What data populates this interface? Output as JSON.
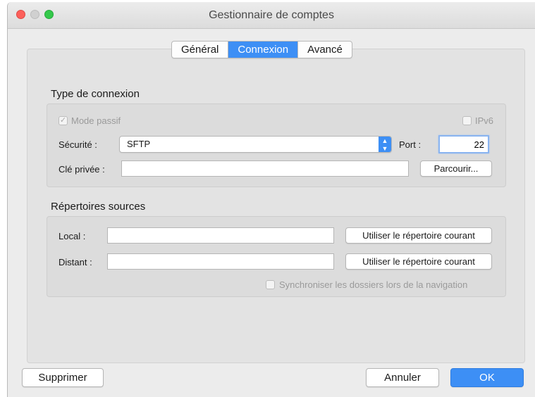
{
  "window": {
    "title": "Gestionnaire de comptes"
  },
  "tabs": [
    {
      "label": "Général",
      "active": false
    },
    {
      "label": "Connexion",
      "active": true
    },
    {
      "label": "Avancé",
      "active": false
    }
  ],
  "connection": {
    "section_title": "Type de connexion",
    "passive_mode_label": "Mode passif",
    "passive_mode_checked": true,
    "ipv6_label": "IPv6",
    "ipv6_checked": false,
    "security_label": "Sécurité :",
    "security_value": "SFTP",
    "port_label": "Port :",
    "port_value": "22",
    "private_key_label": "Clé privée :",
    "private_key_value": "",
    "browse_label": "Parcourir..."
  },
  "directories": {
    "section_title": "Répertoires sources",
    "local_label": "Local :",
    "local_value": "",
    "remote_label": "Distant :",
    "remote_value": "",
    "use_current_label": "Utiliser le répertoire courant",
    "sync_label": "Synchroniser les dossiers lors de la navigation",
    "sync_checked": false
  },
  "footer": {
    "delete_label": "Supprimer",
    "cancel_label": "Annuler",
    "ok_label": "OK"
  },
  "colors": {
    "accent": "#3d8ff5",
    "close": "#fc605b",
    "zoom": "#34c84a"
  }
}
